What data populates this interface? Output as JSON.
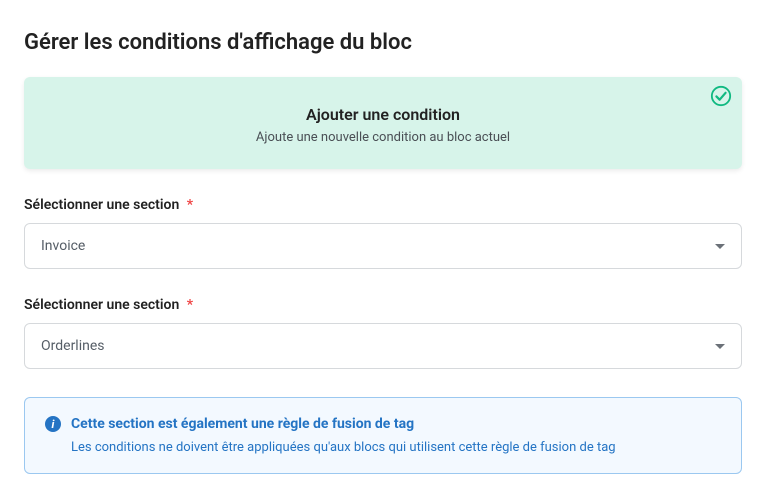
{
  "title": "Gérer les conditions d'affichage du bloc",
  "add_panel": {
    "bg": "#d7f4ea",
    "title": "Ajouter une condition",
    "subtitle": "Ajoute une nouvelle condition au bloc actuel",
    "check_color": "#10b981"
  },
  "fields": [
    {
      "label": "Sélectionner une section",
      "required_mark": "*",
      "value": "Invoice"
    },
    {
      "label": "Sélectionner une section",
      "required_mark": "*",
      "value": "Orderlines"
    }
  ],
  "info": {
    "border": "#9bc8f0",
    "bg": "#f3f9ff",
    "color": "#2474c4",
    "icon_bg": "#2474c4",
    "icon_label": "i",
    "title": "Cette section est également une règle de fusion de tag",
    "body": "Les conditions ne doivent être appliquées qu'aux blocs qui utilisent cette règle de fusion de tag"
  }
}
